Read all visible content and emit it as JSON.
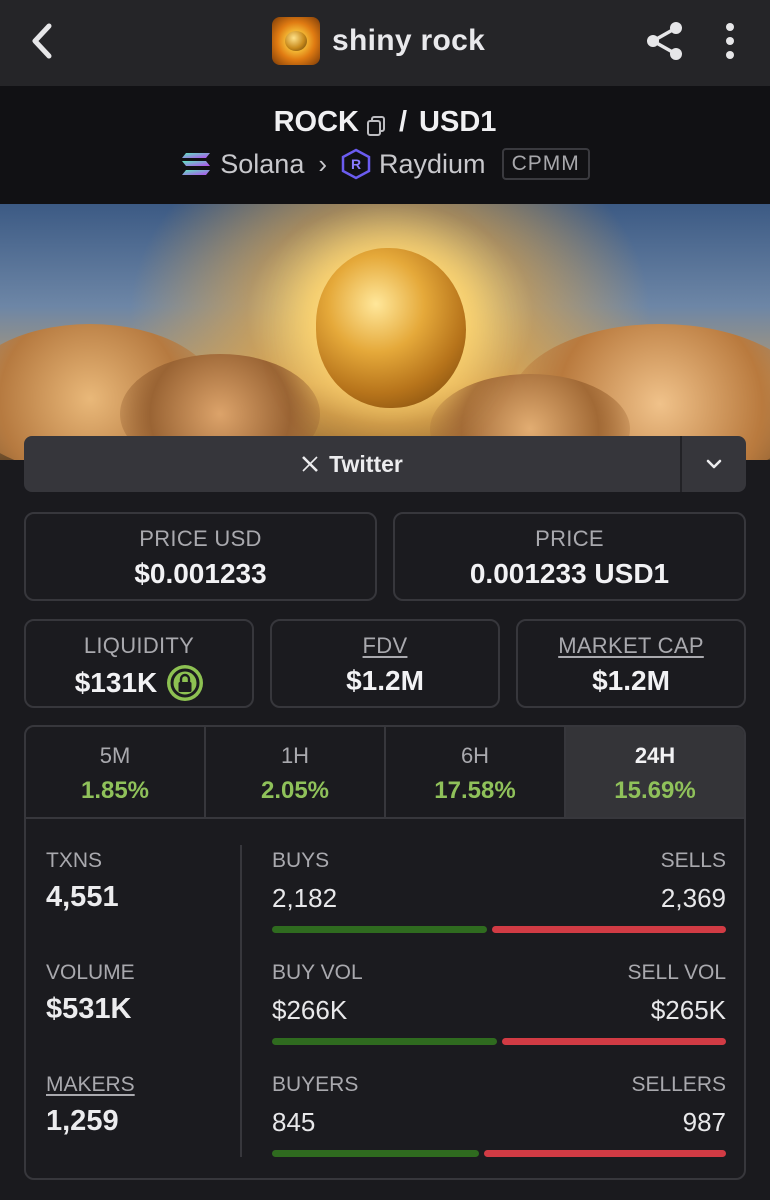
{
  "header": {
    "title": "shiny rock",
    "icons": [
      "back-icon",
      "share-icon",
      "more-vertical-icon"
    ]
  },
  "pair": {
    "base": "ROCK",
    "separator": "/",
    "quote": "USD1",
    "chain": "Solana",
    "dex": "Raydium",
    "pool_type": "CPMM"
  },
  "links": {
    "twitter_label": "Twitter"
  },
  "prices": {
    "price_usd_label": "PRICE USD",
    "price_usd": "$0.001233",
    "price_label": "PRICE",
    "price": "0.001233 USD1"
  },
  "metrics": {
    "liquidity_label": "LIQUIDITY",
    "liquidity": "$131K",
    "fdv_label": "FDV",
    "fdv": "$1.2M",
    "market_cap_label": "MARKET CAP",
    "market_cap": "$1.2M"
  },
  "timeframes": [
    {
      "label": "5M",
      "change": "1.85%"
    },
    {
      "label": "1H",
      "change": "2.05%"
    },
    {
      "label": "6H",
      "change": "17.58%"
    },
    {
      "label": "24H",
      "change": "15.69%",
      "active": true
    }
  ],
  "stats": {
    "txns_label": "TXNS",
    "txns": "4,551",
    "volume_label": "VOLUME",
    "volume": "$531K",
    "makers_label": "MAKERS",
    "makers": "1,259",
    "buys_label": "BUYS",
    "buys": "2,182",
    "sells_label": "SELLS",
    "sells": "2,369",
    "buys_ratio": 0.479,
    "buy_vol_label": "BUY VOL",
    "buy_vol": "$266K",
    "sell_vol_label": "SELL VOL",
    "sell_vol": "$265K",
    "buy_vol_ratio": 0.501,
    "buyers_label": "BUYERS",
    "buyers": "845",
    "sellers_label": "SELLERS",
    "sellers": "987",
    "buyers_ratio": 0.461
  },
  "colors": {
    "positive": "#8fc15a",
    "buy_bar": "#2f6b1f",
    "sell_bar": "#d13b44",
    "lock_badge": "#8dc152"
  }
}
